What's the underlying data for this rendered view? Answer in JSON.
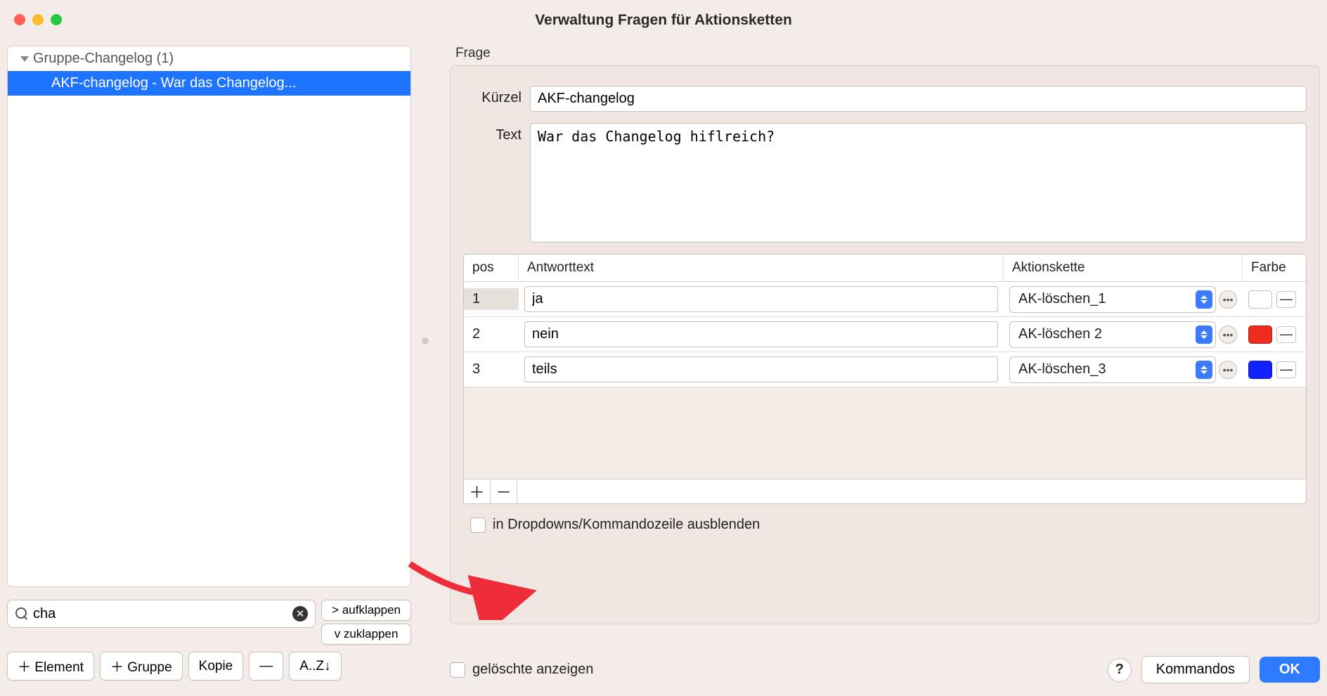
{
  "window_title": "Verwaltung Fragen für Aktionsketten",
  "sidebar": {
    "group_label": "Gruppe-Changelog (1)",
    "item_label": "AKF-changelog - War das Changelog..."
  },
  "search": {
    "value": "cha"
  },
  "fold": {
    "expand_label": ">  aufklappen",
    "collapse_label": "v  zuklappen"
  },
  "left_buttons": {
    "add_element": "＋ Element",
    "add_group": "＋ Gruppe",
    "copy": "Kopie",
    "delete": "—",
    "sort": "A..Z↓"
  },
  "panel": {
    "section_label": "Frage",
    "kuerzel_label": "Kürzel",
    "kuerzel_value": "AKF-changelog",
    "text_label": "Text",
    "text_value": "War das Changelog hiflreich?",
    "table": {
      "head_pos": "pos",
      "head_ant": "Antworttext",
      "head_ak": "Aktionskette",
      "head_farbe": "Farbe",
      "rows": [
        {
          "pos": "1",
          "answer": "ja",
          "chain": "AK-löschen_1",
          "color": "#16e616"
        },
        {
          "pos": "2",
          "answer": "nein",
          "chain": "AK-löschen 2",
          "color": "#ef2b1f"
        },
        {
          "pos": "3",
          "answer": "teils",
          "chain": "AK-löschen_3",
          "color": "#1221ff"
        }
      ]
    },
    "hide_checkbox_label": "in Dropdowns/Kommandozeile ausblenden"
  },
  "footer": {
    "show_deleted_label": "gelöschte anzeigen",
    "kommandos_label": "Kommandos",
    "ok_label": "OK"
  }
}
